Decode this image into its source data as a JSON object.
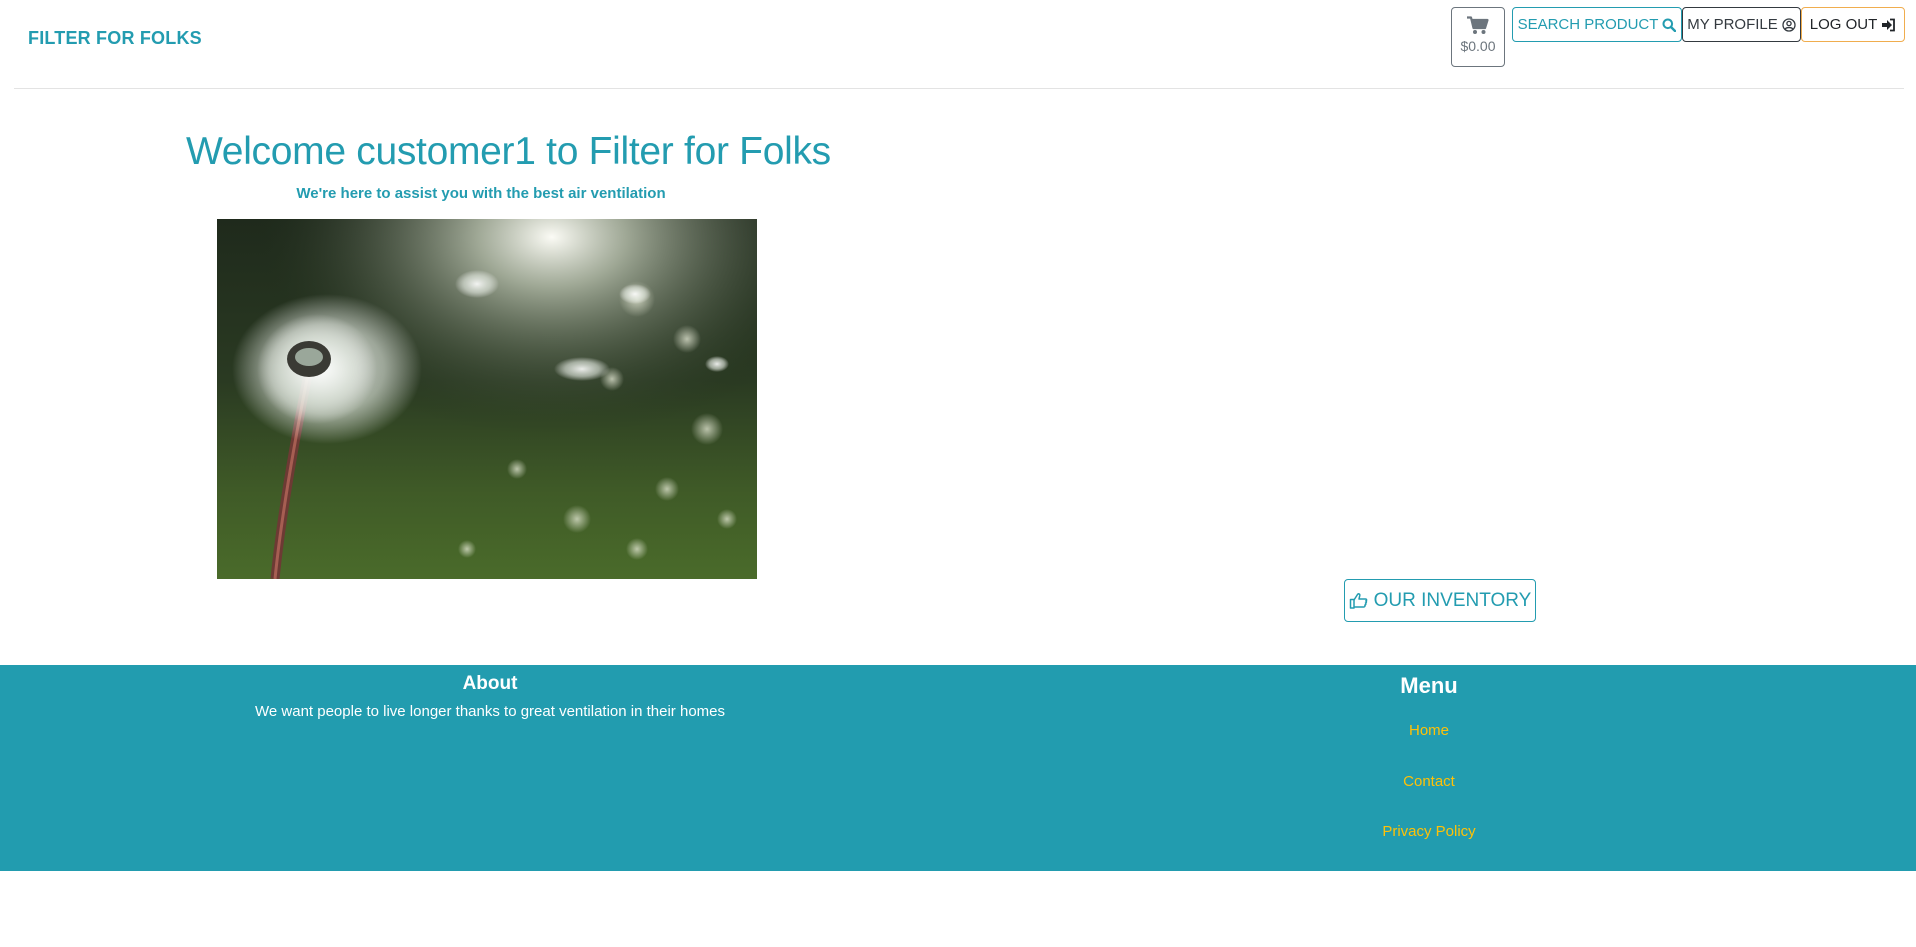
{
  "header": {
    "brand": "FILTER FOR FOLKS",
    "cart_total": "$0.00",
    "search_label": "SEARCH PRODUCT",
    "profile_label": "MY PROFILE",
    "logout_label": "LOG OUT",
    "icons": [
      "cart-icon",
      "search-icon",
      "user-circle-icon",
      "sign-in-icon"
    ]
  },
  "hero": {
    "title": "Welcome customer1 to Filter for Folks",
    "tagline": "We're here to assist you with the best air ventilation",
    "inventory_label": "OUR INVENTORY",
    "inventory_icon": "hand-pointer-icon"
  },
  "footer": {
    "about_title": "About",
    "about_text": "We want people to live longer thanks to great ventilation in their homes",
    "menu_title": "Menu",
    "menu_items": [
      "Home",
      "Contact",
      "Privacy Policy"
    ]
  },
  "colors": {
    "brand": "#239cb0",
    "footer_bg": "#229caf",
    "link": "#ffc107",
    "logout_border": "#f0ad4e"
  }
}
